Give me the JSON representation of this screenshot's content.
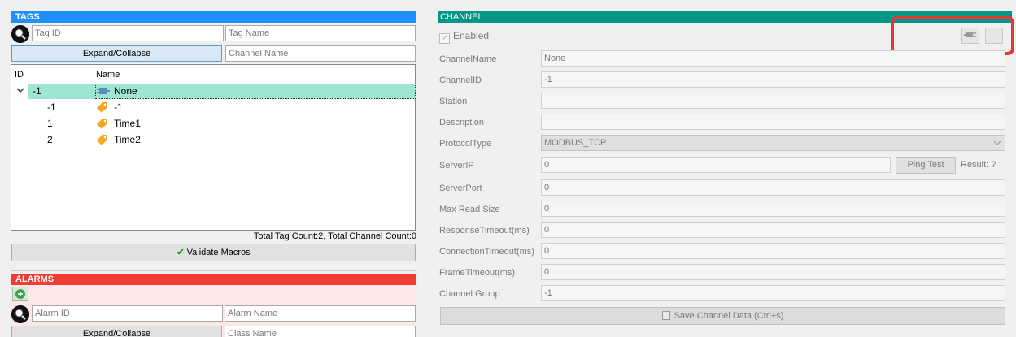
{
  "tags": {
    "header": "TAGS",
    "tag_id_placeholder": "Tag ID",
    "tag_name_placeholder": "Tag Name",
    "expand_label": "Expand/Collapse",
    "channel_name_placeholder": "Channel Name",
    "columns": {
      "id": "ID",
      "name": "Name"
    },
    "rows": [
      {
        "id": "-1",
        "name": "None",
        "icon": "channel-icon",
        "selected": true,
        "expanded": true
      },
      {
        "id": "-1",
        "name": "-1",
        "icon": "tag-icon"
      },
      {
        "id": "1",
        "name": "Time1",
        "icon": "tag-icon"
      },
      {
        "id": "2",
        "name": "Time2",
        "icon": "tag-icon"
      }
    ],
    "count_text": "Total Tag Count:2, Total Channel Count:0",
    "validate_label": "Validate Macros"
  },
  "alarms": {
    "header": "ALARMS",
    "alarm_id_placeholder": "Alarm ID",
    "alarm_name_placeholder": "Alarm Name",
    "expand_label": "Expand/Collapse",
    "class_name_placeholder": "Class Name"
  },
  "channel": {
    "header": "CHANNEL",
    "enabled_label": "Enabled",
    "enabled_checked": true,
    "more_button_label": "...",
    "fields": [
      {
        "label": "ChannelName",
        "value": "None"
      },
      {
        "label": "ChannelID",
        "value": "-1"
      },
      {
        "label": "Station",
        "value": ""
      },
      {
        "label": "Description",
        "value": ""
      },
      {
        "label": "ProtocolType",
        "value": "MODBUS_TCP"
      },
      {
        "label": "ServerIP",
        "value": "0"
      },
      {
        "label": "ServerPort",
        "value": "0"
      },
      {
        "label": "Max Read Size",
        "value": "0"
      },
      {
        "label": "ResponseTimeout(ms)",
        "value": "0"
      },
      {
        "label": "ConnectionTimeout(ms)",
        "value": "0"
      },
      {
        "label": "FrameTimeout(ms)",
        "value": "0"
      },
      {
        "label": "Channel Group",
        "value": "-1"
      }
    ],
    "ping_label": "Ping Test",
    "ping_result": "Result: ?",
    "save_label": "Save Channel Data (Ctrl+s)"
  },
  "colors": {
    "tags_header": "#1e90ff",
    "alarms_header": "#f03c32",
    "channel_header": "#009688",
    "selection": "#a0e5d3",
    "highlight": "#e53935"
  }
}
